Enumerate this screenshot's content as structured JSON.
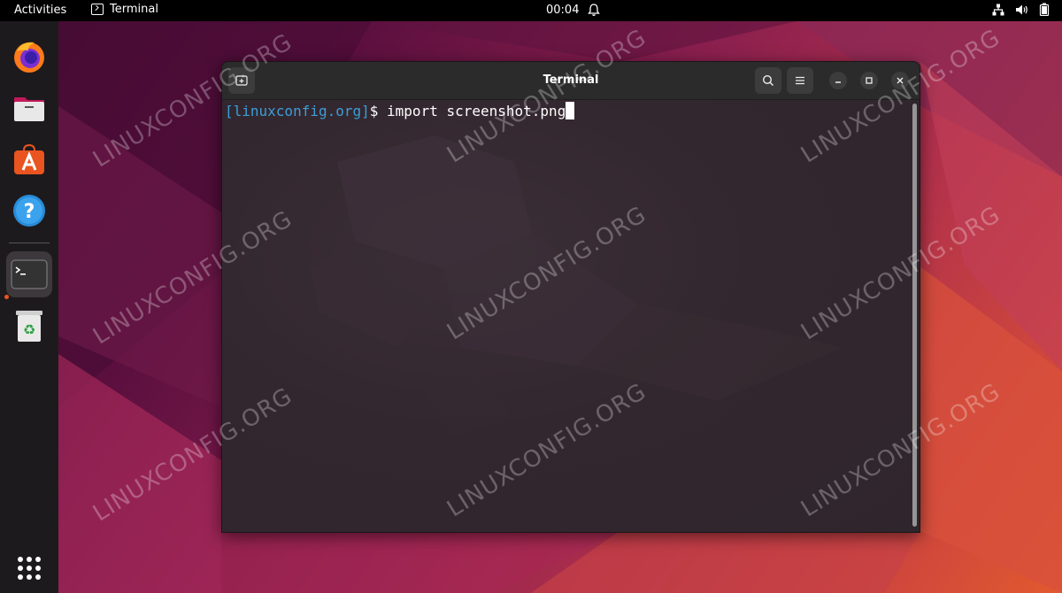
{
  "topbar": {
    "activities": "Activities",
    "app_name": "Terminal",
    "clock": "00:04"
  },
  "dock": {
    "items": [
      {
        "name": "firefox",
        "icon": "firefox-icon"
      },
      {
        "name": "files",
        "icon": "files-icon"
      },
      {
        "name": "app-center",
        "icon": "app-center-icon"
      },
      {
        "name": "help",
        "icon": "help-icon"
      },
      {
        "name": "terminal",
        "icon": "terminal-icon",
        "running": true
      },
      {
        "name": "trash",
        "icon": "trash-icon"
      }
    ],
    "show_apps": "show-apps-icon"
  },
  "terminal": {
    "title": "Terminal",
    "prompt_host": "[linuxconfig.org]",
    "prompt_symbol": "$ ",
    "command": "import screenshot.png"
  },
  "watermark": "LINUXCONFIG.ORG",
  "colors": {
    "accent": "#e95420",
    "prompt_host": "#3b9ed8",
    "dock_bg": "#1d1a1d",
    "titlebar_bg": "#2b2b2b"
  }
}
